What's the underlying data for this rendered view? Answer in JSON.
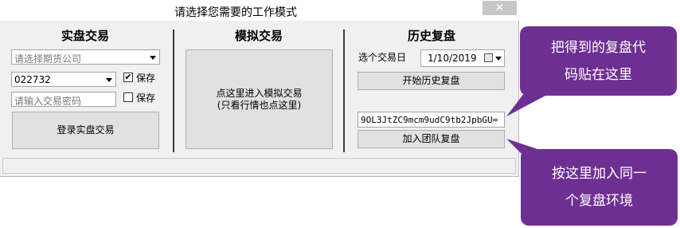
{
  "window": {
    "title": "请选择您需要的工作模式",
    "close_label": "✕"
  },
  "real": {
    "title": "实盘交易",
    "company_placeholder": "请选择期货公司",
    "account_value": "022732",
    "save1_label": "保存",
    "save1_checked": true,
    "password_placeholder": "请输入交易密码",
    "save2_label": "保存",
    "save2_checked": false,
    "login_label": "登录实盘交易"
  },
  "sim": {
    "title": "模拟交易",
    "enter_label": "点这里进入模拟交易\n(只看行情也点这里)"
  },
  "history": {
    "title": "历史复盘",
    "date_label": "选个交易日",
    "date_value": "1/10/2019",
    "start_label": "开始历史复盘",
    "code_value": "9OL3JtZC9mcm9udC9tb2JpbGU=",
    "join_label": "加入团队复盘"
  },
  "callouts": {
    "paste": "把得到的复盘代\n码贴在这里",
    "join": "按这里加入同一\n个复盘环境"
  },
  "colors": {
    "callout_bg": "#6e2f93",
    "window_bg": "#f0f0f0"
  },
  "icons": {
    "close": "close-icon",
    "calendar": "calendar-icon",
    "dropdown": "chevron-down-icon",
    "check": "checkmark-icon"
  }
}
